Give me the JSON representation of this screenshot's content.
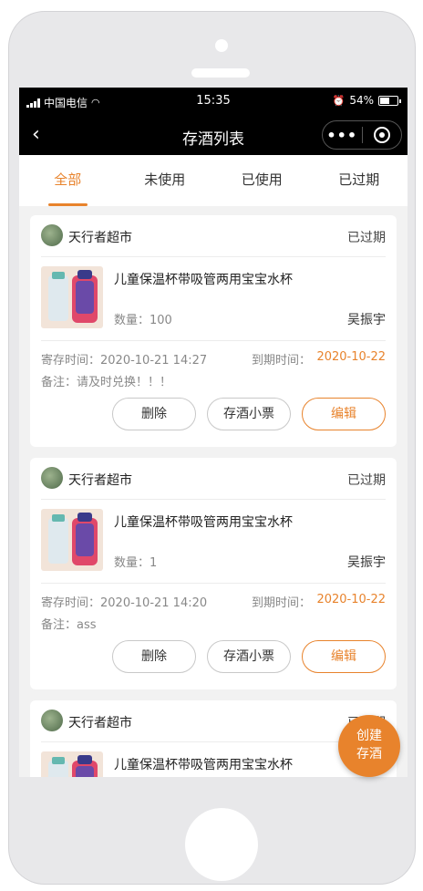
{
  "status_bar": {
    "carrier": "中国电信",
    "time": "15:35",
    "battery": "54%"
  },
  "nav": {
    "title": "存酒列表",
    "more_label": "•••"
  },
  "tabs": [
    {
      "label": "全部",
      "active": true
    },
    {
      "label": "未使用",
      "active": false
    },
    {
      "label": "已使用",
      "active": false
    },
    {
      "label": "已过期",
      "active": false
    }
  ],
  "cards": [
    {
      "store": "天行者超市",
      "status": "已过期",
      "product": "儿童保温杯带吸管两用宝宝水杯",
      "quantity": "数量：100",
      "owner": "吴振宇",
      "deposit_time": "寄存时间：2020-10-21 14:27",
      "expire_label": "到期时间：",
      "expire_date": "2020-10-22",
      "remark": "备注：请及时兑换！！！",
      "buttons": {
        "delete": "删除",
        "receipt": "存酒小票",
        "edit": "编辑"
      }
    },
    {
      "store": "天行者超市",
      "status": "已过期",
      "product": "儿童保温杯带吸管两用宝宝水杯",
      "quantity": "数量：1",
      "owner": "吴振宇",
      "deposit_time": "寄存时间：2020-10-21 14:20",
      "expire_label": "到期时间：",
      "expire_date": "2020-10-22",
      "remark": "备注：ass",
      "buttons": {
        "delete": "删除",
        "receipt": "存酒小票",
        "edit": "编辑"
      }
    },
    {
      "store": "天行者超市",
      "status": "已过期",
      "product": "儿童保温杯带吸管两用宝宝水杯"
    }
  ],
  "fab": {
    "line1": "创建",
    "line2": "存酒"
  },
  "colors": {
    "accent": "#e8832c",
    "nav_bg": "#000000",
    "page_bg": "#f2f2f2"
  },
  "icons": [
    "signal-icon",
    "wifi-icon",
    "alarm-icon",
    "battery-icon",
    "back-arrow-icon",
    "more-icon",
    "target-icon",
    "store-avatar"
  ]
}
